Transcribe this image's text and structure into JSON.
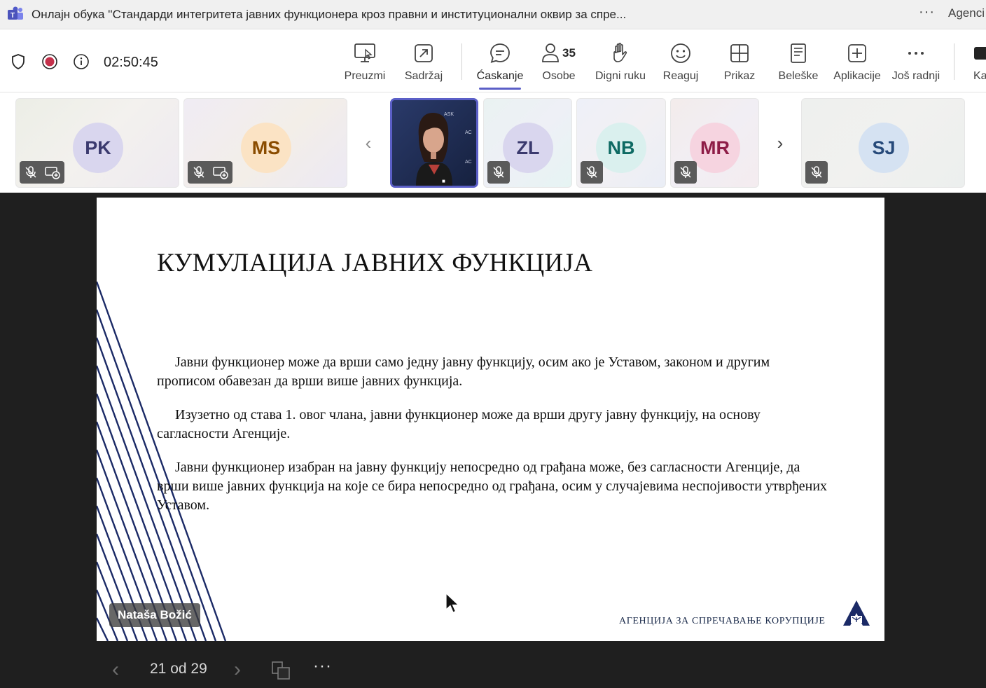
{
  "window": {
    "title": "Онлајн обука ''Стандарди интегритета јавних функционера кроз правни и институционални оквир за спре...",
    "more": "···",
    "right_text": "Agenci"
  },
  "toolbar": {
    "timer": "02:50:45",
    "items": [
      {
        "label": "Preuzmi",
        "icon": "take-control-icon"
      },
      {
        "label": "Sadržaj",
        "icon": "share-content-icon"
      },
      {
        "label": "Ćaskanje",
        "icon": "chat-icon",
        "active": true
      },
      {
        "label": "Osobe",
        "icon": "people-icon",
        "count": "35"
      },
      {
        "label": "Digni ruku",
        "icon": "raise-hand-icon"
      },
      {
        "label": "Reaguj",
        "icon": "react-icon"
      },
      {
        "label": "Prikaz",
        "icon": "view-icon"
      },
      {
        "label": "Beleške",
        "icon": "notes-icon"
      },
      {
        "label": "Aplikacije",
        "icon": "apps-icon"
      },
      {
        "label": "Još radnji",
        "icon": "more-icon"
      }
    ],
    "overflow_label": "Ka",
    "accent_color": "#5b5fc7"
  },
  "participants": [
    {
      "initials": "PK"
    },
    {
      "initials": "MS"
    },
    {
      "initials": "ZL"
    },
    {
      "initials": "NB"
    },
    {
      "initials": "MR"
    },
    {
      "initials": "SJ"
    }
  ],
  "slide": {
    "title": "КУМУЛАЦИЈА ЈАВНИХ ФУНКЦИЈА",
    "paragraphs": [
      "Јавни функционер може да врши само једну јавну функцију, осим ако је Уставом, законом и другим прописом обавезан да врши више јавних функција.",
      "Изузетно од става 1. овог члана, јавни функционер може да врши другу јавну функцију, на основу сагласности Агенције.",
      "Јавни функционер изабран на јавну функцију непосредно од грађана може, без сагласности Агенције, да врши више јавних функција на које се бира непосредно од грађана, осим у случајевима неспојивости утврђених Уставом."
    ],
    "footer": "АГЕНЦИЈА ЗА СПРЕЧАВАЊЕ КОРУПЦИЈЕ",
    "presenter": "Nataša Božić"
  },
  "pager": {
    "text": "21 od 29",
    "more": "···"
  }
}
